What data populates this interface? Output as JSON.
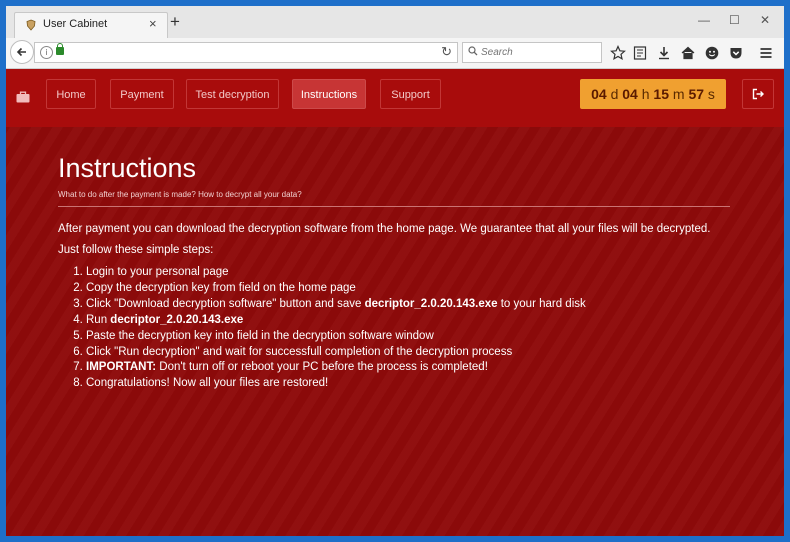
{
  "browser": {
    "tab_title": "User Cabinet",
    "search_placeholder": "Search",
    "url": ""
  },
  "app_nav": {
    "items": [
      {
        "label": "Home",
        "active": false
      },
      {
        "label": "Payment",
        "active": false
      },
      {
        "label": "Test decryption",
        "active": false
      },
      {
        "label": "Instructions",
        "active": true
      },
      {
        "label": "Support",
        "active": false
      }
    ]
  },
  "timer": {
    "days": "04",
    "days_unit": "d",
    "hours": "04",
    "hours_unit": "h",
    "minutes": "15",
    "minutes_unit": "m",
    "seconds": "57",
    "seconds_unit": "s"
  },
  "colors": {
    "background": "#8e0a0a",
    "nav_bar": "#a80c0c",
    "active_nav": "#c73535",
    "timer": "#f0a030"
  },
  "page": {
    "title": "Instructions",
    "subtitle": "What to do after the payment is made? How to decrypt all your data?",
    "intro": "After payment you can download the decryption software from the home page. We guarantee that all your files will be decrypted.",
    "steps_intro": "Just follow these simple steps:",
    "steps": [
      {
        "prefix": "",
        "bold": "",
        "text": "Login to your personal page",
        "suffix": ""
      },
      {
        "prefix": "",
        "bold": "",
        "text": "Copy the decryption key from field on the home page",
        "suffix": ""
      },
      {
        "prefix": "Click \"Download decryption software\" button and save ",
        "bold": "decriptor_2.0.20.143.exe",
        "text": "",
        "suffix": " to your hard disk"
      },
      {
        "prefix": "Run ",
        "bold": "decriptor_2.0.20.143.exe",
        "text": "",
        "suffix": ""
      },
      {
        "prefix": "",
        "bold": "",
        "text": "Paste the decryption key into field in the decryption software window",
        "suffix": ""
      },
      {
        "prefix": "",
        "bold": "",
        "text": "Click \"Run decryption\" and wait for successfull completion of the decryption process",
        "suffix": ""
      },
      {
        "prefix": "",
        "bold": "IMPORTANT:",
        "text": "",
        "suffix": " Don't turn off or reboot your PC before the process is completed!"
      },
      {
        "prefix": "",
        "bold": "",
        "text": "Congratulations! Now all your files are restored!",
        "suffix": ""
      }
    ]
  }
}
